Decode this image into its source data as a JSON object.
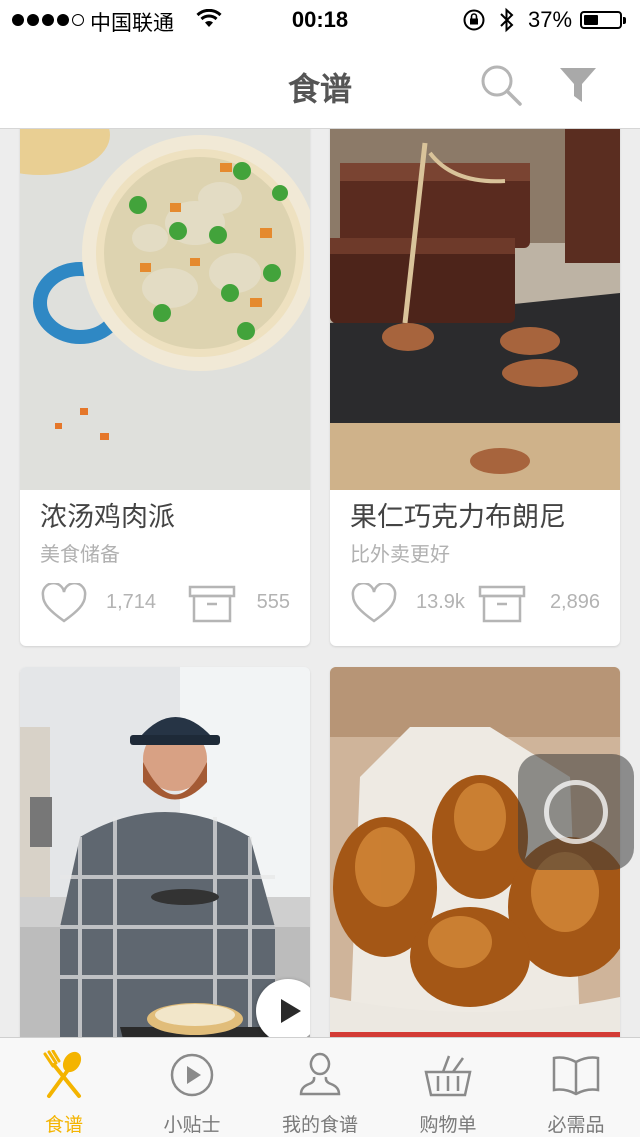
{
  "status_bar": {
    "carrier": "中国联通",
    "time": "00:18",
    "battery": "37%",
    "battery_level": 0.37
  },
  "header": {
    "title": "食谱"
  },
  "colors": {
    "accent": "#f4b400",
    "icon_gray": "#b5b5b5",
    "text_dark": "#444444",
    "text_light": "#b1b1b1"
  },
  "recipes": [
    {
      "title": "浓汤鸡肉派",
      "subtitle": "美食储备",
      "likes": "1,714",
      "saves": "555"
    },
    {
      "title": "果仁巧克力布朗尼",
      "subtitle": "比外卖更好",
      "likes": "13.9k",
      "saves": "2,896"
    }
  ],
  "tabs": [
    {
      "label": "食谱",
      "icon": "spoon-fork-icon",
      "active": true
    },
    {
      "label": "小贴士",
      "icon": "play-circle-icon",
      "active": false
    },
    {
      "label": "我的食谱",
      "icon": "user-icon",
      "active": false
    },
    {
      "label": "购物单",
      "icon": "basket-icon",
      "active": false
    },
    {
      "label": "必需品",
      "icon": "book-icon",
      "active": false
    }
  ]
}
